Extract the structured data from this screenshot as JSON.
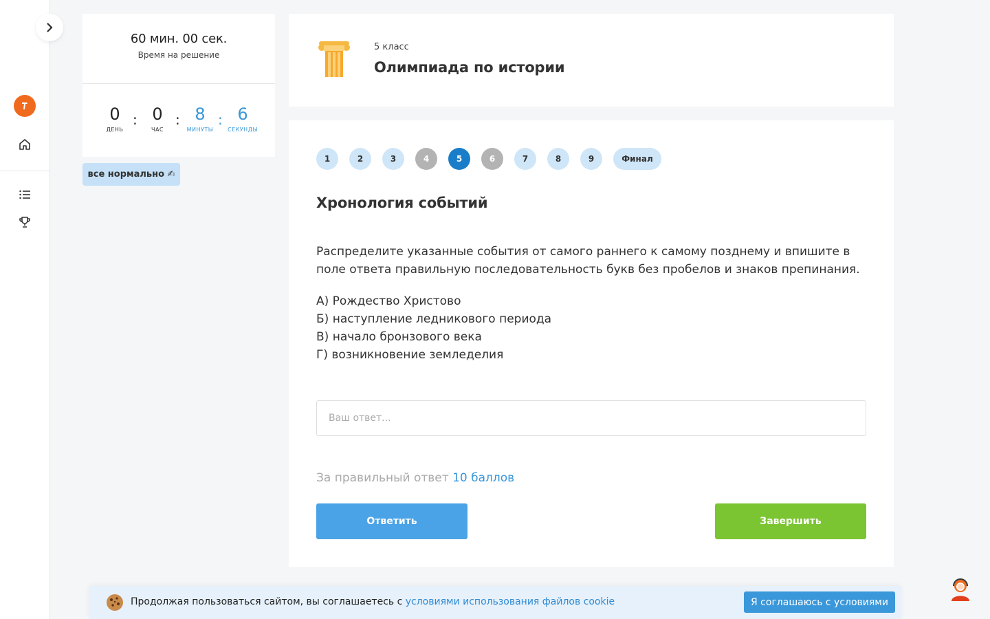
{
  "timer": {
    "total": "60 мин. 00 сек.",
    "caption": "Время на решение",
    "countdown": [
      {
        "value": "0",
        "label": "ДЕНЬ"
      },
      {
        "value": "0",
        "label": "ЧАС"
      },
      {
        "value": "8",
        "label": "МИНУТЫ"
      },
      {
        "value": "6",
        "label": "СЕКУНДЫ"
      }
    ],
    "separator": ":"
  },
  "status_badge": "все нормально ✍",
  "header": {
    "grade": "5 класс",
    "title": "Олимпиада по истории"
  },
  "steps": [
    {
      "label": "1",
      "state": "default"
    },
    {
      "label": "2",
      "state": "default"
    },
    {
      "label": "3",
      "state": "default"
    },
    {
      "label": "4",
      "state": "done"
    },
    {
      "label": "5",
      "state": "active"
    },
    {
      "label": "6",
      "state": "done"
    },
    {
      "label": "7",
      "state": "default"
    },
    {
      "label": "8",
      "state": "default"
    },
    {
      "label": "9",
      "state": "default"
    },
    {
      "label": "Финал",
      "state": "default"
    }
  ],
  "task": {
    "title": "Хронология событий",
    "text": "Распределите указанные события от самого раннего к самому позднему и впишите в поле ответа правильную последовательность букв без пробелов и знаков препинания.",
    "options": [
      "А) Рождество Христово",
      "Б) наступление ледникового периода",
      "В) начало бронзового века",
      "Г) возникновение земледелия"
    ],
    "answer_placeholder": "Ваш ответ...",
    "answer_value": "",
    "points_prefix": "За правильный ответ",
    "points_value": "10 баллов"
  },
  "buttons": {
    "answer": "Ответить",
    "finish": "Завершить"
  },
  "cookie": {
    "text": "Продолжая пользоваться сайтом, вы соглашаетесь с",
    "link": "условиями использования файлов cookie",
    "accept": "Я соглашаюсь с условиями"
  },
  "colors": {
    "accent_blue": "#3a97d9",
    "active_step": "#1a7dc9",
    "finish_green": "#7cc532",
    "brand_orange": "#f06a1d"
  },
  "icons": {
    "rail": [
      "chevron-right-icon",
      "logo-icon",
      "home-icon",
      "list-icon",
      "trophy-icon"
    ],
    "header": "column-icon",
    "cookie": "cookie-icon",
    "support": "support-icon"
  }
}
